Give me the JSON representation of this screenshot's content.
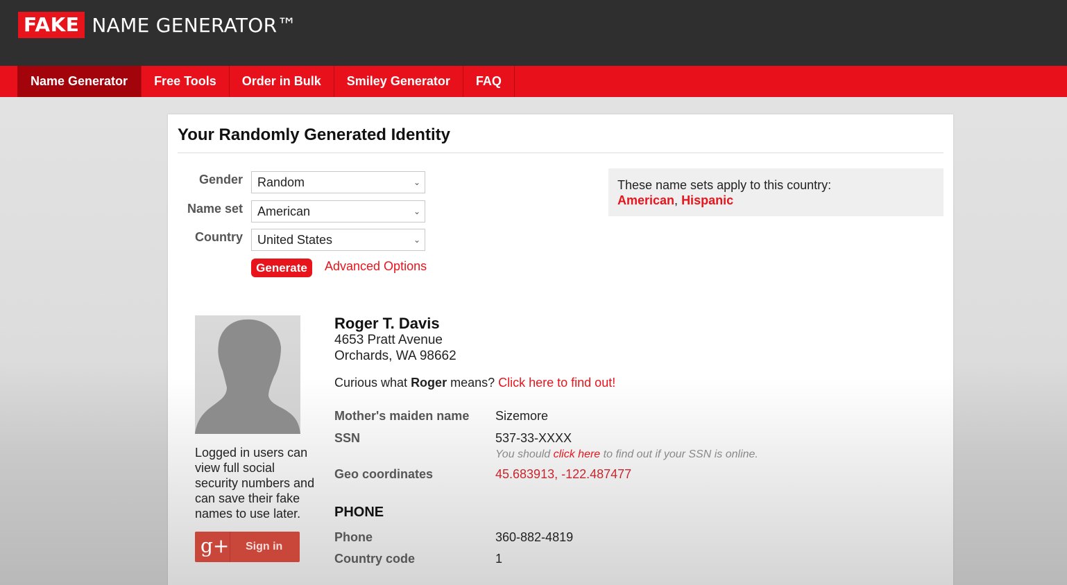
{
  "header": {
    "logo_fake": "FAKE",
    "logo_rest": "NAME GENERATOR™"
  },
  "nav": {
    "items": [
      {
        "label": "Name Generator",
        "active": true
      },
      {
        "label": "Free Tools"
      },
      {
        "label": "Order in Bulk"
      },
      {
        "label": "Smiley Generator"
      },
      {
        "label": "FAQ"
      }
    ]
  },
  "main": {
    "title": "Your Randomly Generated Identity",
    "form": {
      "gender_label": "Gender",
      "gender_value": "Random",
      "nameset_label": "Name set",
      "nameset_value": "American",
      "country_label": "Country",
      "country_value": "United States",
      "generate_label": "Generate",
      "advanced_label": "Advanced Options"
    },
    "nameset_box": {
      "text": "These name sets apply to this country:",
      "set1": "American",
      "separator": ", ",
      "set2": "Hispanic"
    }
  },
  "identity": {
    "name": "Roger T. Davis",
    "address_line1": "4653 Pratt Avenue",
    "address_line2": "Orchards, WA 98662",
    "curious_prefix": "Curious what ",
    "curious_name": "Roger",
    "curious_suffix": " means? ",
    "curious_link": "Click here to find out!",
    "login_note": "Logged in users can view full social security numbers and can save their fake names to use later.",
    "gplus_icon": "g+",
    "gplus_label": "Sign in",
    "fields": {
      "maiden_label": "Mother's maiden name",
      "maiden_value": "Sizemore",
      "ssn_label": "SSN",
      "ssn_value": "537-33-XXXX",
      "ssn_note_prefix": "You should ",
      "ssn_note_link": "click here",
      "ssn_note_suffix": " to find out if your SSN is online.",
      "geo_label": "Geo coordinates",
      "geo_value": "45.683913, -122.487477"
    },
    "phone_section": {
      "heading": "PHONE",
      "phone_label": "Phone",
      "phone_value": "360-882-4819",
      "cc_label": "Country code",
      "cc_value": "1"
    }
  },
  "colors": {
    "brand_red": "#e8141c",
    "header_dark": "#2f2f2f",
    "nav_active": "#a3040c",
    "gplus_red": "#c8463a"
  }
}
